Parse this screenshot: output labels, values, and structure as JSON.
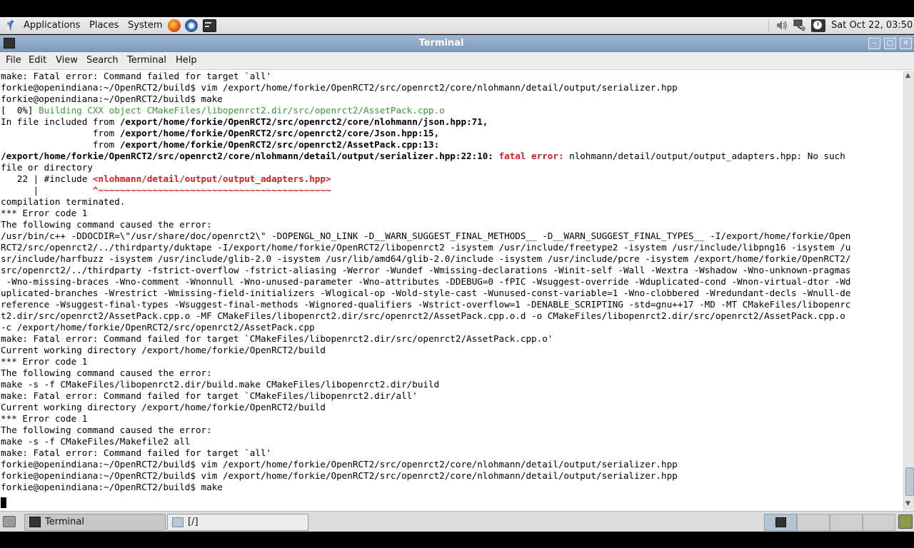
{
  "panel": {
    "menus": [
      "Applications",
      "Places",
      "System"
    ],
    "clock": "Sat Oct 22, 03:50"
  },
  "window": {
    "title": "Terminal",
    "menubar": [
      "File",
      "Edit",
      "View",
      "Search",
      "Terminal",
      "Help"
    ]
  },
  "terminal": {
    "lines": [
      "make: Fatal error: Command failed for target `all'",
      "forkie@openindiana:~/OpenRCT2/build$ vim /export/home/forkie/OpenRCT2/src/openrct2/core/nlohmann/detail/output/serializer.hpp",
      "forkie@openindiana:~/OpenRCT2/build$ make",
      "[  0%] Building CXX object CMakeFiles/libopenrct2.dir/src/openrct2/AssetPack.cpp.o",
      "In file included from /export/home/forkie/OpenRCT2/src/openrct2/core/nlohmann/json.hpp:71,",
      "                 from /export/home/forkie/OpenRCT2/src/openrct2/core/Json.hpp:15,",
      "                 from /export/home/forkie/OpenRCT2/src/openrct2/AssetPack.cpp:13:",
      "/export/home/forkie/OpenRCT2/src/openrct2/core/nlohmann/detail/output/serializer.hpp:22:10: fatal error: nlohmann/detail/output/output_adapters.hpp: No such",
      "file or directory",
      "   22 | #include <nlohmann/detail/output/output_adapters.hpp>",
      "      |          ^~~~~~~~~~~~~~~~~~~~~~~~~~~~~~~~~~~~~~~~~~~~",
      "compilation terminated.",
      "*** Error code 1",
      "The following command caused the error:",
      "/usr/bin/c++ -DDOCDIR=\\\"/usr/share/doc/openrct2\\\" -DOPENGL_NO_LINK -D__WARN_SUGGEST_FINAL_METHODS__ -D__WARN_SUGGEST_FINAL_TYPES__ -I/export/home/forkie/Open",
      "RCT2/src/openrct2/../thirdparty/duktape -I/export/home/forkie/OpenRCT2/libopenrct2 -isystem /usr/include/freetype2 -isystem /usr/include/libpng16 -isystem /u",
      "sr/include/harfbuzz -isystem /usr/include/glib-2.0 -isystem /usr/lib/amd64/glib-2.0/include -isystem /usr/include/pcre -isystem /export/home/forkie/OpenRCT2/",
      "src/openrct2/../thirdparty -fstrict-overflow -fstrict-aliasing -Werror -Wundef -Wmissing-declarations -Winit-self -Wall -Wextra -Wshadow -Wno-unknown-pragmas",
      " -Wno-missing-braces -Wno-comment -Wnonnull -Wno-unused-parameter -Wno-attributes -DDEBUG=0 -fPIC -Wsuggest-override -Wduplicated-cond -Wnon-virtual-dtor -Wd",
      "uplicated-branches -Wrestrict -Wmissing-field-initializers -Wlogical-op -Wold-style-cast -Wunused-const-variable=1 -Wno-clobbered -Wredundant-decls -Wnull-de",
      "reference -Wsuggest-final-types -Wsuggest-final-methods -Wignored-qualifiers -Wstrict-overflow=1 -DENABLE_SCRIPTING -std=gnu++17 -MD -MT CMakeFiles/libopenrc",
      "t2.dir/src/openrct2/AssetPack.cpp.o -MF CMakeFiles/libopenrct2.dir/src/openrct2/AssetPack.cpp.o.d -o CMakeFiles/libopenrct2.dir/src/openrct2/AssetPack.cpp.o",
      "-c /export/home/forkie/OpenRCT2/src/openrct2/AssetPack.cpp",
      "make: Fatal error: Command failed for target `CMakeFiles/libopenrct2.dir/src/openrct2/AssetPack.cpp.o'",
      "Current working directory /export/home/forkie/OpenRCT2/build",
      "*** Error code 1",
      "The following command caused the error:",
      "make -s -f CMakeFiles/libopenrct2.dir/build.make CMakeFiles/libopenrct2.dir/build",
      "make: Fatal error: Command failed for target `CMakeFiles/libopenrct2.dir/all'",
      "Current working directory /export/home/forkie/OpenRCT2/build",
      "*** Error code 1",
      "The following command caused the error:",
      "make -s -f CMakeFiles/Makefile2 all",
      "make: Fatal error: Command failed for target `all'",
      "forkie@openindiana:~/OpenRCT2/build$ vim /export/home/forkie/OpenRCT2/src/openrct2/core/nlohmann/detail/output/serializer.hpp",
      "forkie@openindiana:~/OpenRCT2/build$ vim /export/home/forkie/OpenRCT2/src/openrct2/core/nlohmann/detail/output/serializer.hpp",
      "forkie@openindiana:~/OpenRCT2/build$ make"
    ]
  },
  "taskbar": {
    "items": [
      {
        "label": "Terminal",
        "icon": "terminal-icon",
        "active": true
      },
      {
        "label": "[/]",
        "icon": "folder-icon",
        "active": false
      }
    ]
  },
  "colors": {
    "progress": "#3a9b32",
    "error": "#cc2222",
    "titlebar": "#8aa5c6"
  }
}
